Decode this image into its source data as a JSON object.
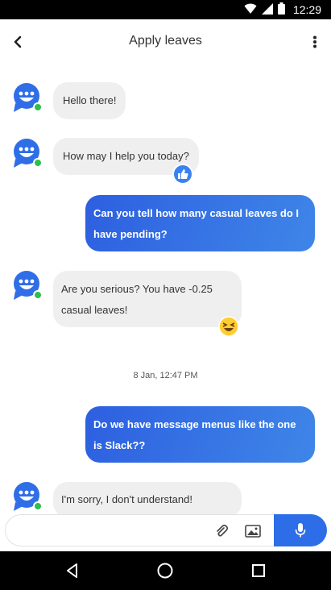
{
  "status_bar": {
    "time": "12:29"
  },
  "app_bar": {
    "title": "Apply leaves"
  },
  "messages": [
    {
      "from": "bot",
      "text": "Hello there!"
    },
    {
      "from": "bot",
      "text": "How may I help you today?",
      "reaction": "thumbs-up"
    },
    {
      "from": "user",
      "text": "Can you tell how many casual leaves do I have pending?"
    },
    {
      "from": "bot",
      "text": "Are you serious? You have -0.25 casual leaves!",
      "reaction": "laughing-emoji"
    },
    {
      "timestamp": "8 Jan, 12:47 PM"
    },
    {
      "from": "user",
      "text": "Do we have message menus like the one is Slack??"
    },
    {
      "from": "bot",
      "text": "I'm sorry, I don't understand!"
    }
  ],
  "composer": {
    "placeholder": ""
  },
  "colors": {
    "accent": "#2d6ee8",
    "bot_bubble": "#efefef",
    "online": "#2fbf4a"
  }
}
